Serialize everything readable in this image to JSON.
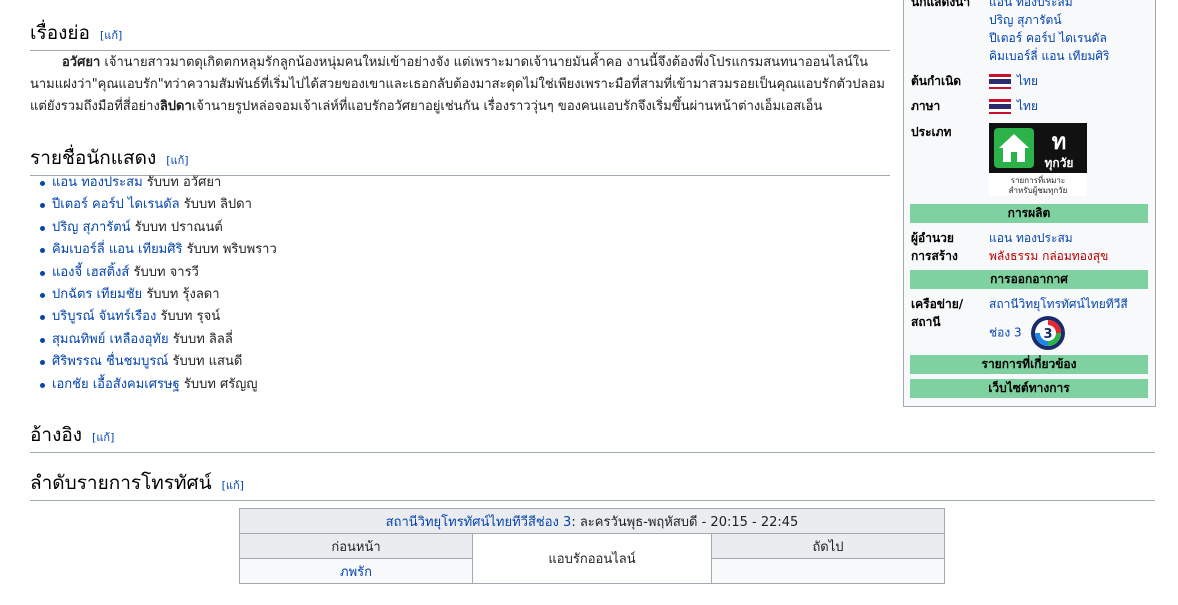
{
  "sections": {
    "plot": {
      "title": "เรื่องย่อ",
      "edit": "[แก้]"
    },
    "cast": {
      "title": "รายชื่อนักแสดง",
      "edit": "[แก้]"
    },
    "refs": {
      "title": "อ้างอิง",
      "edit": "[แก้]"
    },
    "schedule": {
      "title": "ลำดับรายการโทรทัศน์",
      "edit": "[แก้]"
    }
  },
  "plot": {
    "name1": "อวัศยา",
    "text1": " เจ้านายสาวมาตดุเกิดตกหลุมรักลูกน้องหนุ่มคนใหม่เข้าอย่างจัง แต่เพราะมาดเจ้านายมันค้ำคอ งานนี้จึงต้องพึ่งโปรแกรมสนทนาออนไลน์ในนามแฝงว่า\"คุณแอบรัก\"ทว่าความสัมพันธ์ที่เริ่มไปได้สวยของเขาและเธอกลับต้องมาสะดุดไม่ใช่เพียงเพราะมือที่สามที่เข้ามาสวมรอยเป็นคุณแอบรักตัวปลอมแต่ยังรวมถึงมือที่สี่อย่าง",
    "name2": "ลิปดา",
    "text2": "เจ้านายรูปหล่อจอมเจ้าเล่ห์ที่แอบรักอวัศยาอยู่เช่นกัน เรื่องราววุ่นๆ ของคนแอบรักจึงเริ่มขึ้นผ่านหน้าต่างเอ็มเอสเอ็น"
  },
  "cast": [
    {
      "actor": "แอน ทองประสม",
      "role": " รับบท อวัศยา"
    },
    {
      "actor": "ปีเตอร์ คอร์ป ไดเรนดัล",
      "role": " รับบท ลิปดา"
    },
    {
      "actor": "ปริญ สุภารัตน์",
      "role": " รับบท ปราณนต์"
    },
    {
      "actor": "คิมเบอร์ลี่ แอน เทียมศิริ",
      "role": " รับบท พริบพราว"
    },
    {
      "actor": "แองจี้ เฮสติ้งส์",
      "role": " รับบท จารวี"
    },
    {
      "actor": "ปกฉัตร เทียมชัย",
      "role": " รับบท รุ้งลดา"
    },
    {
      "actor": "บริบูรณ์ จันทร์เรือง",
      "role": " รับบท รุจน์"
    },
    {
      "actor": "สุมณทิพย์ เหลืองอุทัย",
      "role": " รับบท ลิลลี่"
    },
    {
      "actor": "ศิริพรรณ ชื่นชมบูรณ์",
      "role": " รับบท แสนดี"
    },
    {
      "actor": "เอกชัย เอื้อสังคมเศรษฐ",
      "role": " รับบท ศรัญญู"
    }
  ],
  "succession": {
    "station_link": "สถานีวิทยุโทรทัศน์ไทยทีวีสีช่อง 3",
    "airtime": ": ละครวันพุธ-พฤหัสบดี - 20:15 - 22:45",
    "prev_label": "ก่อนหน้า",
    "next_label": "ถัดไป",
    "prev_value": "ภพรัก",
    "current": "แอบรักออนไลน์",
    "next_value": ""
  },
  "infobox": {
    "starring_label": "นักแสดงนำ",
    "starring": [
      "แอน ทองประสม",
      "ปริญ สุภารัตน์",
      "ปีเตอร์ คอร์ป ไดเรนดัล",
      "คิมเบอร์ลี่ แอน เทียมศิริ"
    ],
    "origin_label": "ต้นกำเนิด",
    "origin": "ไทย",
    "language_label": "ภาษา",
    "language": "ไทย",
    "genre_label": "ประเภท",
    "rating_letter": "ท",
    "rating_word": "ทุกวัย",
    "rating_caption1": "รายการที่เหมาะ",
    "rating_caption2": "สำหรับผู้ชมทุกวัย",
    "production_bar": "การผลิต",
    "director_label1": "ผู้อำนวย",
    "director_label2": "การสร้าง",
    "director": "แอน ทองประสม",
    "company": "พลังธรรม กล่อมทองสุข",
    "broadcast_bar": "การออกอากาศ",
    "network_label1": "เครือข่าย/",
    "network_label2": "สถานี",
    "network": "สถานีวิทยุโทรทัศน์ไทยทีวีสี",
    "channel": "ช่อง 3",
    "related_bar": "รายการที่เกี่ยวข้อง",
    "website_bar": "เว็บไซต์ทางการ"
  },
  "colors": {
    "link": "#0645ad",
    "redlink": "#ba0000",
    "infobox_bar": "#7fd1a0"
  }
}
